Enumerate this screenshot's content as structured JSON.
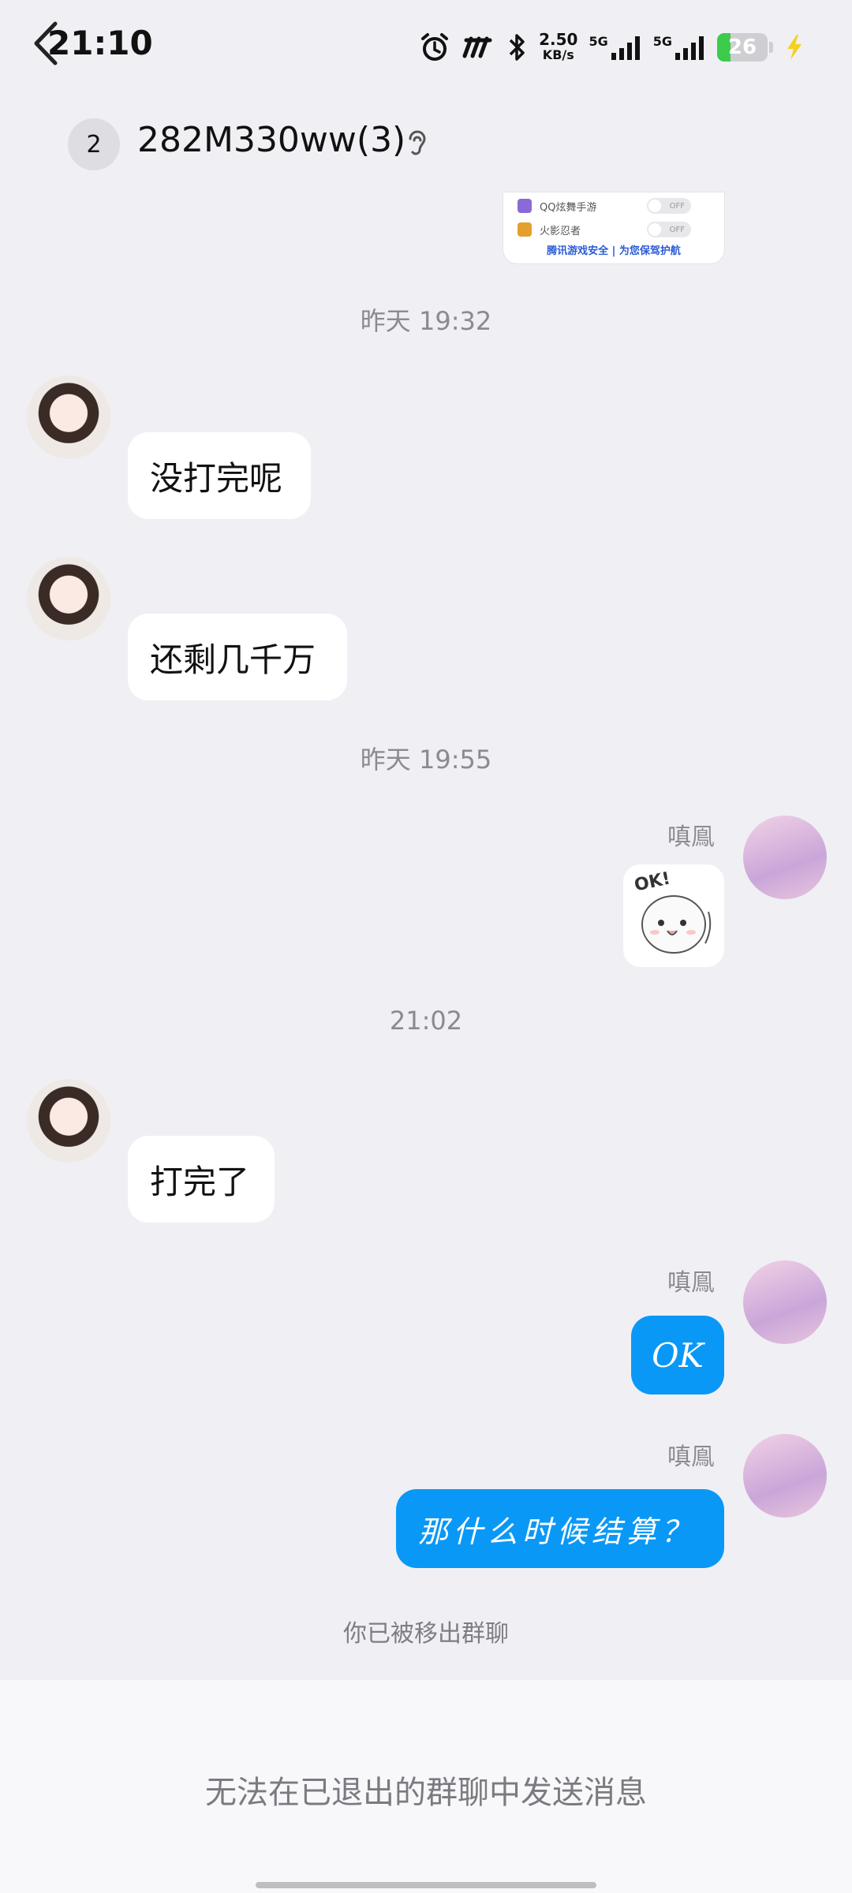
{
  "status_bar": {
    "time": "21:10",
    "speed_value": "2.50",
    "speed_unit": "KB/s",
    "sim1_label": "5G",
    "sim2_label": "5G",
    "battery_level": "26",
    "battery_percent": 26,
    "battery_color": "#3ccb4a",
    "icons": [
      "alarm-icon",
      "app-icon",
      "bluetooth-icon",
      "signal-icon",
      "signal-icon",
      "battery-icon",
      "charging-icon"
    ]
  },
  "header": {
    "back_icon": "chevron-left-icon",
    "unread_count": "2",
    "title": "282M330ww(3)",
    "earpiece_icon": "ear-icon"
  },
  "partial_image": {
    "rows": [
      {
        "label": "QQ炫舞手游",
        "toggle": "OFF"
      },
      {
        "label": "火影忍者",
        "toggle": "OFF"
      }
    ],
    "footer": "腾讯游戏安全 | 为您保驾护航"
  },
  "messages": {
    "time1": "昨天 19:32",
    "msg1": "没打完呢",
    "msg2": "还剩几千万",
    "time2": "昨天 19:55",
    "sender_name": "嗔鳯",
    "sticker": "OK!",
    "time3": "21:02",
    "msg3": "打完了",
    "msg4": "OK",
    "msg5": "那什么时候结算？",
    "removed_notice": "你已被移出群聊"
  },
  "footer": {
    "cannot_send": "无法在已退出的群聊中发送消息"
  },
  "colors": {
    "background": "#f0eff4",
    "bubble_blue": "#0a98f7",
    "bubble_white": "#ffffff",
    "muted_text": "#8a8a90"
  }
}
